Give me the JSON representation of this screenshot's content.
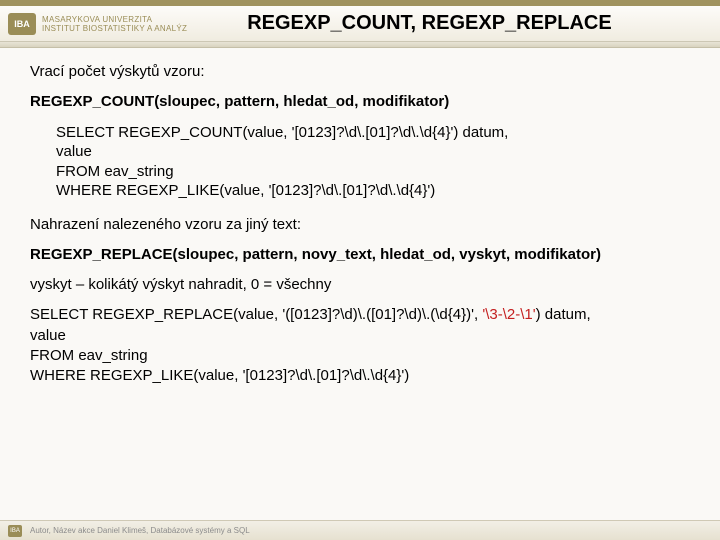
{
  "header": {
    "logo_text": "IBA",
    "uni_line1": "MASARYKOVA UNIVERZITA",
    "uni_line2": "INSTITUT BIOSTATISTIKY A ANALÝZ",
    "title": "REGEXP_COUNT, REGEXP_REPLACE"
  },
  "body": {
    "intro": "Vrací počet výskytů vzoru:",
    "syntax1": "REGEXP_COUNT(sloupec, pattern, hledat_od, modifikator)",
    "code1_l1": "SELECT REGEXP_COUNT(value, '[0123]?\\d\\.[01]?\\d\\.\\d{4}') datum,",
    "code1_l2": "value",
    "code1_l3": "FROM eav_string",
    "code1_l4": "WHERE REGEXP_LIKE(value, '[0123]?\\d\\.[01]?\\d\\.\\d{4}')",
    "replace_intro": "Nahrazení nalezeného vzoru za jiný text:",
    "syntax2": "REGEXP_REPLACE(sloupec, pattern, novy_text, hledat_od, vyskyt, modifikator)",
    "vyskyt": "vyskyt – kolikátý výskyt nahradit, 0 = všechny",
    "code2_l1a": "SELECT REGEXP_REPLACE(value, '([0123]?\\d)\\.([01]?\\d)\\.(\\d{4})', ",
    "code2_l1b": "'\\3-\\2-\\1'",
    "code2_l1c": ") datum,",
    "code2_l2": "value",
    "code2_l3": "FROM eav_string",
    "code2_l4": "WHERE REGEXP_LIKE(value, '[0123]?\\d\\.[01]?\\d\\.\\d{4}')"
  },
  "footer": {
    "icon": "IBA",
    "text": "Autor, Název akce   Daniel Klimeš, Databázové systémy a SQL"
  }
}
